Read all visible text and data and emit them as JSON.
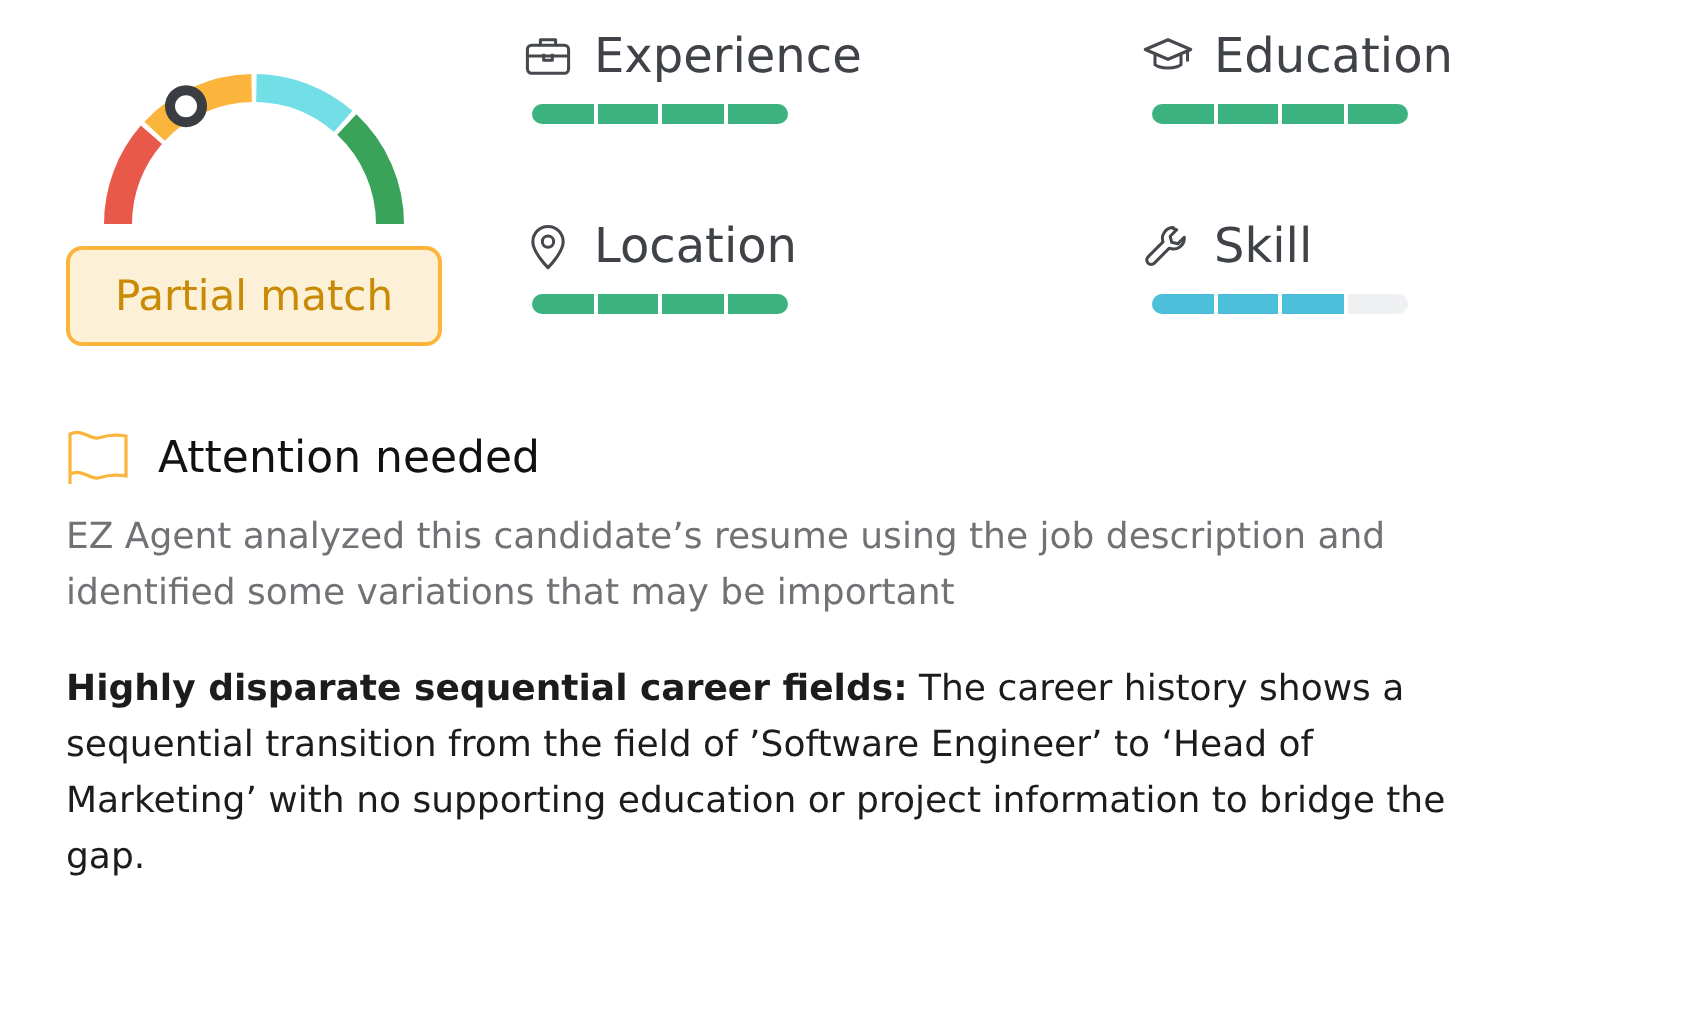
{
  "gauge": {
    "badge": "Partial match"
  },
  "criteria": [
    {
      "kind": "briefcase",
      "label": "Experience",
      "level": 1,
      "color": "#3bb27f"
    },
    {
      "kind": "cap",
      "label": "Education",
      "level": 1,
      "color": "#3bb27f"
    },
    {
      "kind": "pin",
      "label": "Location",
      "level": 1,
      "color": "#3bb27f"
    },
    {
      "kind": "wrench",
      "label": "Skill",
      "level": 0.75,
      "color": "#4cbfdb"
    }
  ],
  "attention": {
    "title": "Attention needed",
    "summary": "EZ Agent analyzed this candidate’s resume using the job description and identified some variations that may be important",
    "finding": "**Highly disparate sequential career fields:** The career history shows a sequential transition from the field of ’Software Engineer’ to ‘Head of Marketing’ with no supporting education or project information to bridge the gap."
  }
}
